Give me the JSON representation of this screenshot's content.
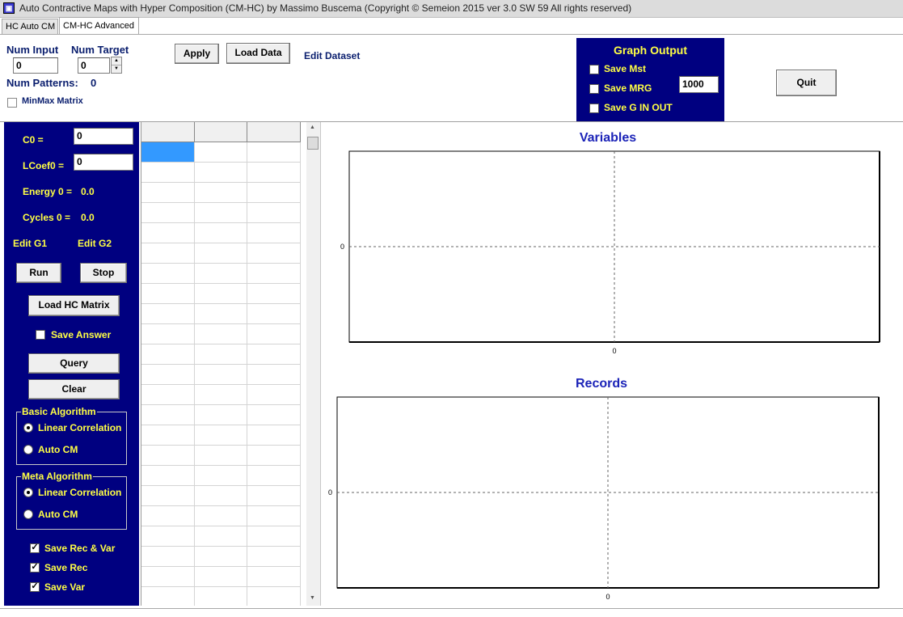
{
  "window": {
    "title": "Auto Contractive Maps with Hyper Composition  (CM-HC) by Massimo Buscema (Copyright © Semeion 2015 ver 3.0 SW 59 All rights reserved)",
    "icon": "app-icon"
  },
  "tabs": [
    {
      "label": "HC Auto CM",
      "active": false
    },
    {
      "label": "CM-HC Advanced",
      "active": true
    }
  ],
  "top": {
    "num_input_label": "Num Input",
    "num_input_value": "0",
    "num_target_label": "Num Target",
    "num_target_value": "0",
    "num_patterns_label": "Num Patterns:",
    "num_patterns_value": "0",
    "minmax_label": "MinMax Matrix",
    "minmax_checked": false,
    "apply_label": "Apply",
    "load_data_label": "Load Data",
    "edit_dataset_label": "Edit Dataset",
    "quit_label": "Quit"
  },
  "graph_output": {
    "title": "Graph Output",
    "save_mst_label": "Save Mst",
    "save_mrg_label": "Save MRG",
    "mrg_value": "1000",
    "save_g_label": "Save G IN OUT"
  },
  "left_panel": {
    "c0_label": "C0 =",
    "c0_value": "0",
    "lcoef0_label": "LCoef0 =",
    "lcoef0_value": "0",
    "energy_label": "Energy 0 =",
    "energy_value": "0.0",
    "cycles_label": "Cycles 0 =",
    "cycles_value": "0.0",
    "edit_g1_label": "Edit G1",
    "edit_g2_label": "Edit G2",
    "run_label": "Run",
    "stop_label": "Stop",
    "load_hc_label": "Load HC Matrix",
    "save_answer_label": "Save Answer",
    "query_label": "Query",
    "clear_label": "Clear",
    "basic_algorithm": {
      "title": "Basic Algorithm",
      "options": [
        "Linear Correlation",
        "Auto CM"
      ],
      "selected": "Linear Correlation"
    },
    "meta_algorithm": {
      "title": "Meta Algorithm",
      "options": [
        "Linear Correlation",
        "Auto CM"
      ],
      "selected": "Linear Correlation"
    },
    "save_rec_var_label": "Save Rec & Var",
    "save_rec_label": "Save Rec",
    "save_var_label": "Save Var"
  },
  "colors": {
    "panel_blue": "#000080",
    "panel_text": "#ffff44",
    "chart_title": "#1c24b8",
    "grid_selected": "#3399ff"
  },
  "chart_data": [
    {
      "type": "scatter",
      "title": "Variables",
      "xlabel": "",
      "ylabel": "",
      "x_ticks": [
        "0"
      ],
      "y_ticks": [
        "0"
      ],
      "series": [],
      "grid": "dashed center lines"
    },
    {
      "type": "scatter",
      "title": "Records",
      "xlabel": "",
      "ylabel": "",
      "x_ticks": [
        "0"
      ],
      "y_ticks": [
        "0"
      ],
      "series": [],
      "grid": "dashed center lines"
    }
  ]
}
